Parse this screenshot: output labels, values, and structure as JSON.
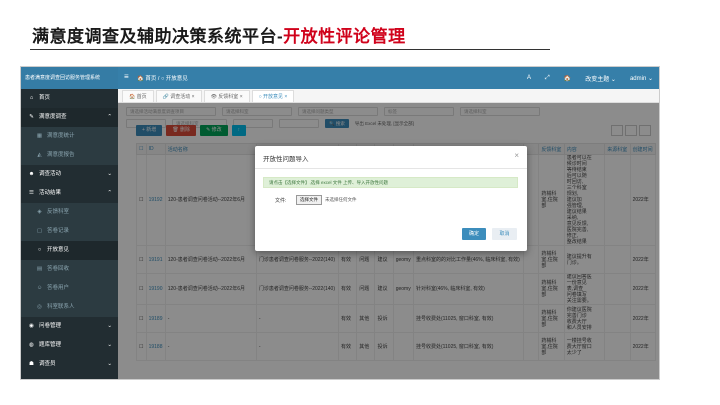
{
  "slide": {
    "title_main": "满意度调查及辅助决策系统平台-",
    "title_accent": "开放性评论管理"
  },
  "header": {
    "brand": "患者满意度调查回访服务管理系统",
    "breadcrumb": "🏠 首页 / ○ 开放意见",
    "right_items": [
      "A",
      "⤢",
      "🏠",
      "改变主题 ⌄",
      "admin ⌄"
    ]
  },
  "sidebar": {
    "items": [
      {
        "icon": "home-icon",
        "label": "首页",
        "type": "parent",
        "chevron": ""
      },
      {
        "icon": "survey-icon",
        "label": "满意度调查",
        "type": "active",
        "chevron": "⌃"
      },
      {
        "icon": "building-icon",
        "label": "满意度统计",
        "type": "sub",
        "chevron": ""
      },
      {
        "icon": "chart-icon",
        "label": "满意度报告",
        "type": "sub",
        "chevron": ""
      },
      {
        "icon": "users-icon",
        "label": "调查活动",
        "type": "parent",
        "chevron": "⌄"
      },
      {
        "icon": "list-icon",
        "label": "活动结果",
        "type": "parent",
        "chevron": "⌃"
      },
      {
        "icon": "feedback-icon",
        "label": "反馈科室",
        "type": "sub",
        "chevron": ""
      },
      {
        "icon": "record-icon",
        "label": "答卷记录",
        "type": "sub",
        "chevron": ""
      },
      {
        "icon": "circle-icon",
        "label": "开放意见",
        "type": "active",
        "chevron": ""
      },
      {
        "icon": "trash-icon",
        "label": "答卷回收",
        "type": "sub",
        "chevron": ""
      },
      {
        "icon": "user-icon",
        "label": "答卷用户",
        "type": "sub",
        "chevron": ""
      },
      {
        "icon": "contact-icon",
        "label": "科室联系人",
        "type": "sub",
        "chevron": ""
      },
      {
        "icon": "questionnaire-icon",
        "label": "问卷管理",
        "type": "parent",
        "chevron": "⌄"
      },
      {
        "icon": "database-icon",
        "label": "题库管理",
        "type": "parent",
        "chevron": "⌄"
      },
      {
        "icon": "team-icon",
        "label": "调查员",
        "type": "parent",
        "chevron": "⌄"
      }
    ]
  },
  "tabs": [
    {
      "label": "🏠 首页",
      "active": false
    },
    {
      "label": "🔗 调查活动 ×",
      "active": false
    },
    {
      "label": "👁 反馈科室 ×",
      "active": false
    },
    {
      "label": "○ 开放意见 ×",
      "active": true
    }
  ],
  "filters": {
    "row1": [
      "请选择活动满意度调查项目",
      "请选择科室",
      "请选择问题类型",
      "标签",
      "请选择科室"
    ],
    "row2": [
      "",
      "请选择科室",
      "",
      ""
    ],
    "search_label": "🔍 搜索",
    "link_label": "导出 Excel 未处理, [显示全部]"
  },
  "toolbar": {
    "add": "+ 新增",
    "delete": "🗑 删除",
    "edit": "✎ 修改",
    "import": "↑"
  },
  "table": {
    "columns": [
      "☐",
      "ID",
      "活动名称",
      "",
      "",
      "",
      "",
      "",
      "",
      "",
      "",
      "",
      "",
      "",
      "反馈科室",
      "内容",
      "来源科室",
      "创建时间"
    ],
    "rows": [
      {
        "id": "19192",
        "name": "120-患者调查问卷活动--2022年6月",
        "c3": "",
        "c4": "",
        "c5": "",
        "c6": "",
        "c7": "",
        "c8": "",
        "c9": "",
        "dept": "药械科\n室,住院\n部",
        "content": "患者可以在\n候诊时间\n等待结束\n后可以随\n时回访,\n三个科室\n规划,\n建议加\n强管理,\n建议结果\n采纳,\n意见反馈,\n医院完善,\n修正,\n整改结果",
        "src": "",
        "time": "2022年"
      },
      {
        "id": "19191",
        "name": "120-患者调查问卷活动--2022年6月",
        "c3": "门诊患者调查问卷服务--2022(140)",
        "c4": "有效",
        "c5": "问题",
        "c6": "建议",
        "c7": "geomy",
        "c8": "重点科室的的对比工作量(46%, 临床科室, 有效)",
        "c9": "",
        "dept": "药械科\n室,住院\n部",
        "content": "建议提升有\n门诊。",
        "src": "",
        "time": "2022年"
      },
      {
        "id": "19190",
        "name": "120-患者调查问卷活动--2022年6月",
        "c3": "门诊患者调查问卷服务--2022(140)",
        "c4": "有效",
        "c5": "问题",
        "c6": "建议",
        "c7": "geomy",
        "c8": "针对科室(46%, 临床科室, 有效)",
        "c9": "",
        "dept": "药械科\n室,住院\n部",
        "content": "建议回答医\n一份意见\n表,调查\n问卷填写\n关注需要。",
        "src": "",
        "time": "2022年"
      },
      {
        "id": "19189",
        "name": "-",
        "c3": "-",
        "c4": "有效",
        "c5": "其他",
        "c6": "投诉",
        "c7": "",
        "c8": "挂号收费处(11025, 窗口科室, 有效)",
        "c9": "",
        "dept": "药械科\n室,住院\n部",
        "content": "你建议医院\n完善门诊\n收费大厅\n和人员安排",
        "src": "",
        "time": "2022年"
      },
      {
        "id": "19188",
        "name": "-",
        "c3": "-",
        "c4": "有效",
        "c5": "其他",
        "c6": "投诉",
        "c7": "",
        "c8": "挂号收费处(11025, 窗口科室, 有效)",
        "c9": "",
        "dept": "药械科\n室,住院\n部",
        "content": "一楼挂号收\n费大厅窗口\n太少了",
        "src": "",
        "time": "2022年"
      }
    ]
  },
  "modal": {
    "title": "开放性问题导入",
    "close": "×",
    "alert": "请点击【选择文件】,选择 excel 文件 上传、导入开放性问题",
    "file_label": "文件:",
    "file_button": "选择文件",
    "file_status": "未选择任何文件",
    "ok": "确定",
    "cancel": "取消"
  },
  "colors": {
    "header": "#367fa9",
    "sidebar": "#222d32",
    "accent": "#d0021b",
    "primary": "#3c8dbc"
  }
}
